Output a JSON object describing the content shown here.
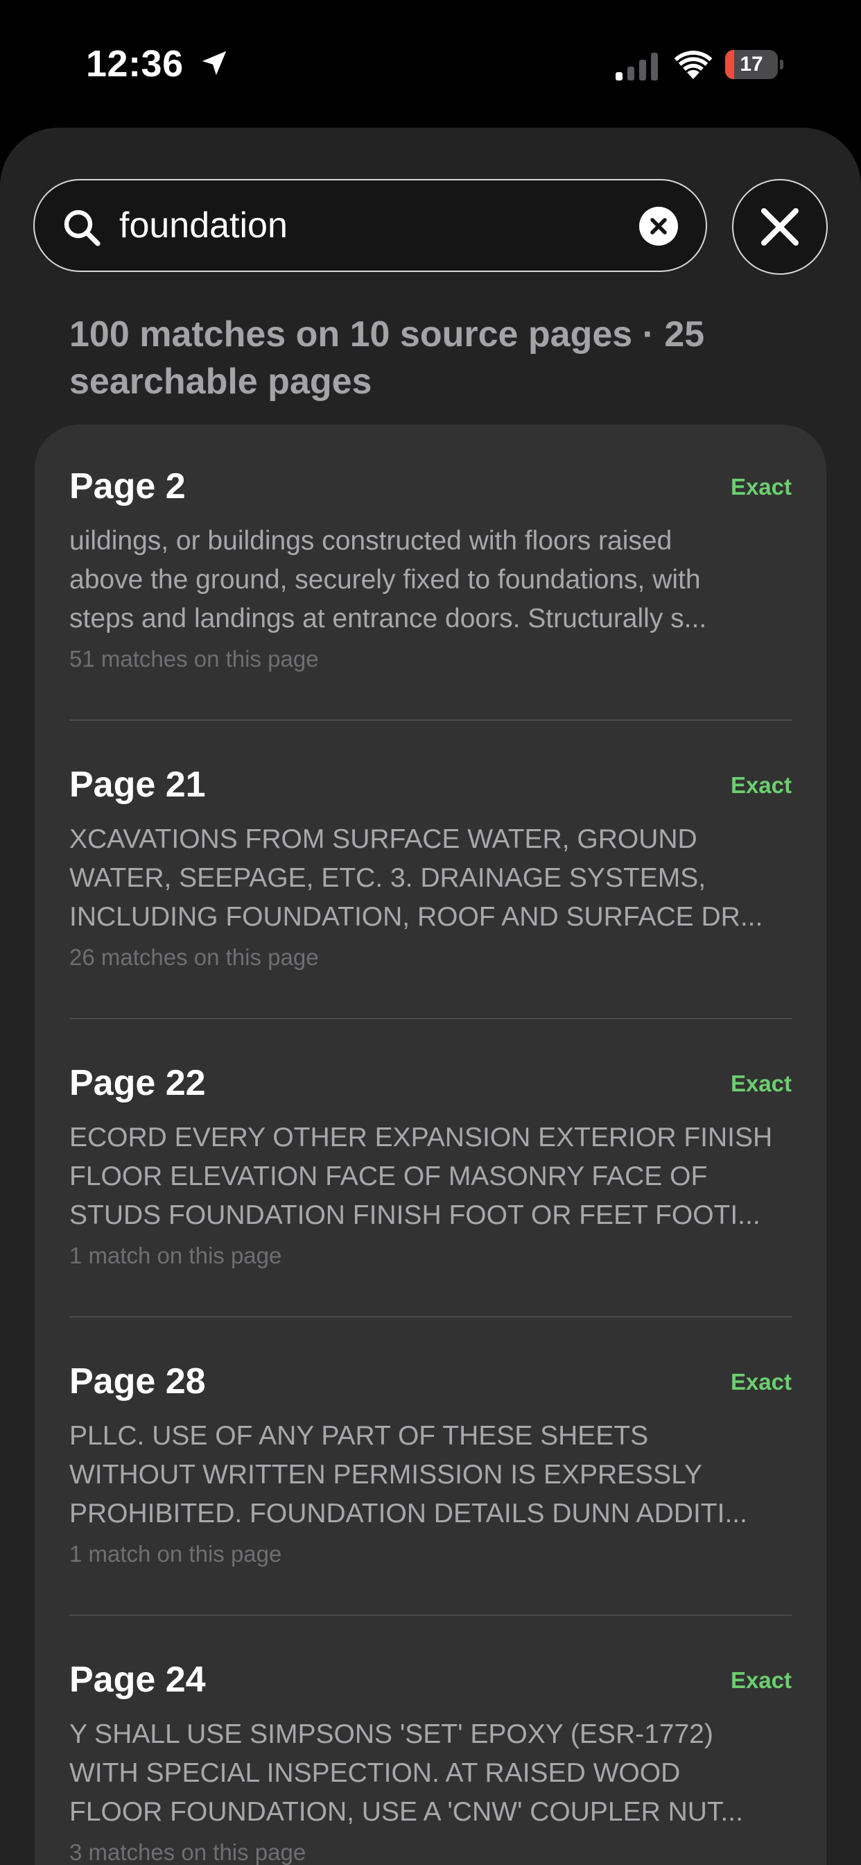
{
  "status_bar": {
    "time": "12:36",
    "battery_level": "17",
    "battery_fraction": 0.17,
    "location_icon": "location-arrow-icon",
    "signal_icon": "cellular-signal-icon",
    "wifi_icon": "wifi-icon"
  },
  "search": {
    "query": "foundation",
    "icon": "search-icon",
    "clear_icon": "clear-icon",
    "close_icon": "close-icon"
  },
  "summary": "100 matches on 10 source pages · 25 searchable pages",
  "colors": {
    "background": "#000000",
    "sheet": "#232323",
    "card": "#323232",
    "badge": "#6bcf6f",
    "battery_low": "#eb4e3d"
  },
  "results": [
    {
      "title": "Page 2",
      "badge": "Exact",
      "snippet_lines": [
        "uildings, or buildings constructed with floors raised",
        "above the ground, securely fixed to foundations, with",
        "steps and landings at entrance doors. Structurally s..."
      ],
      "count": "51 matches on this page"
    },
    {
      "title": "Page 21",
      "badge": "Exact",
      "snippet_lines": [
        "XCAVATIONS FROM SURFACE WATER, GROUND",
        "WATER, SEEPAGE, ETC. 3. DRAINAGE SYSTEMS,",
        "INCLUDING FOUNDATION, ROOF AND SURFACE DR..."
      ],
      "count": "26 matches on this page"
    },
    {
      "title": "Page 22",
      "badge": "Exact",
      "snippet_lines": [
        "ECORD EVERY OTHER EXPANSION EXTERIOR FINISH",
        "FLOOR ELEVATION FACE OF MASONRY FACE OF",
        "STUDS FOUNDATION FINISH FOOT OR FEET FOOTI..."
      ],
      "count": "1 match on this page"
    },
    {
      "title": "Page 28",
      "badge": "Exact",
      "snippet_lines": [
        "PLLC. USE OF ANY PART OF THESE SHEETS",
        "WITHOUT WRITTEN PERMISSION IS EXPRESSLY",
        "PROHIBITED. FOUNDATION DETAILS DUNN ADDITI..."
      ],
      "count": "1 match on this page"
    },
    {
      "title": "Page 24",
      "badge": "Exact",
      "snippet_lines": [
        "Y SHALL USE SIMPSONS 'SET' EPOXY (ESR-1772)",
        "WITH SPECIAL INSPECTION. AT RAISED WOOD",
        "FLOOR FOUNDATION, USE A 'CNW' COUPLER NUT..."
      ],
      "count": "3 matches on this page"
    }
  ]
}
